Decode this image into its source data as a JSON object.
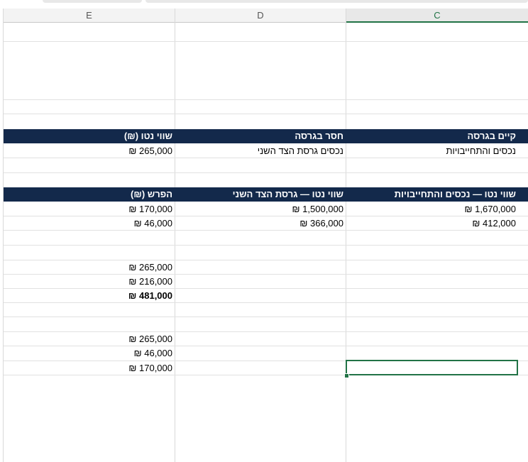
{
  "columns": {
    "e": "E",
    "d": "D",
    "c": "C"
  },
  "table1": {
    "headers": {
      "c": "קיים בגרסה",
      "d": "חסר בגרסה",
      "e": "שווי נטו (₪)"
    },
    "row": {
      "c": "נכסים והתחייבויות",
      "d": "נכסים גרסת הצד השני",
      "e": "265,000 ₪"
    }
  },
  "table2": {
    "headers": {
      "c": "שווי נטו — נכסים והתחייבויות",
      "d": "שווי נטו — גרסת הצד השני",
      "e": "הפרש (₪)"
    },
    "rows": [
      {
        "c": "1,670,000 ₪",
        "d": "1,500,000 ₪",
        "e": "170,000 ₪"
      },
      {
        "c": "412,000 ₪",
        "d": "366,000 ₪",
        "e": "46,000 ₪"
      }
    ]
  },
  "block3": [
    "265,000 ₪",
    "216,000 ₪",
    "481,000 ₪"
  ],
  "block4": [
    "265,000 ₪",
    "46,000 ₪",
    "170,000 ₪"
  ]
}
